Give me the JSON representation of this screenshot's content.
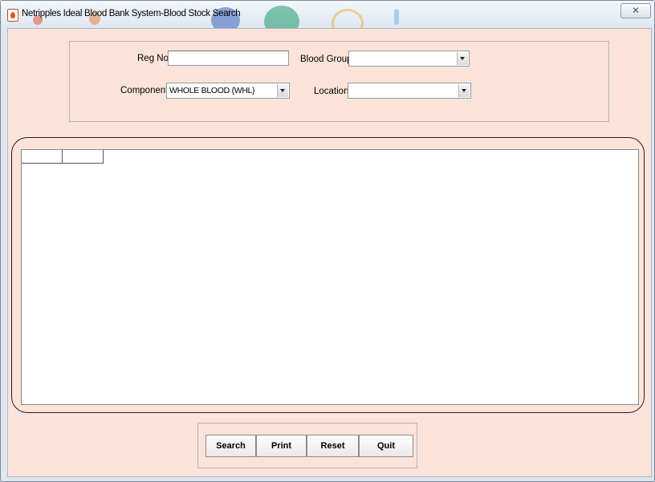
{
  "window": {
    "title": "Netripples Ideal Blood Bank System-Blood Stock Search",
    "icon": "blood-drop-icon",
    "close_glyph": "✕"
  },
  "filters": {
    "reg_no": {
      "label": "Reg No.",
      "value": ""
    },
    "blood_group": {
      "label": "Blood Group",
      "value": ""
    },
    "component": {
      "label": "Component",
      "value": "WHOLE BLOOD {WHL}"
    },
    "location": {
      "label": "Location",
      "value": ""
    }
  },
  "grid": {
    "columns": [
      "",
      ""
    ],
    "rows": []
  },
  "buttons": {
    "search": "Search",
    "print": "Print",
    "reset": "Reset",
    "quit": "Quit"
  },
  "colors": {
    "client_background": "#fce3d9",
    "grid_background": "#ffffff"
  }
}
